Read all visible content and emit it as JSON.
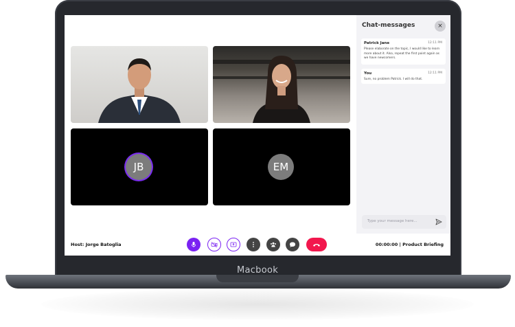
{
  "device": {
    "brand": "Macbook"
  },
  "participants": [
    {
      "type": "video",
      "scene": "man in suit, office"
    },
    {
      "type": "video",
      "scene": "woman smiling, loft"
    },
    {
      "type": "avatar",
      "initials": "JB",
      "speaking": true
    },
    {
      "type": "avatar",
      "initials": "EM",
      "speaking": false
    }
  ],
  "chat": {
    "title": "Chat-messages",
    "close_label": "×",
    "messages": [
      {
        "sender": "Patrick Jane",
        "time": "12:11 PM",
        "text": "Please elaborate on the topic, I would like to learn more about it. Also, repeat the first point again as we have newcomers."
      },
      {
        "sender": "You",
        "time": "12:11 PM",
        "text": "Sure, no problem Patrick. I will do that."
      }
    ],
    "input_placeholder": "Type your message here..."
  },
  "controls": {
    "host_label": "Host: Jorge Batoglia",
    "session_label": "00:00:00 | Product Briefing",
    "buttons": [
      "microphone-icon",
      "camera-off-icon",
      "share-screen-icon",
      "more-icon",
      "participants-icon",
      "chat-icon",
      "end-call-icon"
    ]
  },
  "colors": {
    "accent": "#7a22f2",
    "end_call": "#f2174d",
    "dark_button": "#444444",
    "chat_bg": "#f3f3f6"
  }
}
